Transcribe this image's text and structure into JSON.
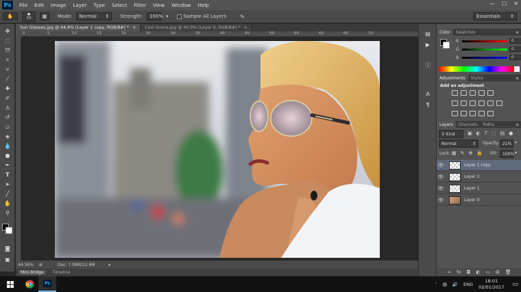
{
  "app": {
    "logo": "Ps"
  },
  "menu": [
    "File",
    "Edit",
    "Image",
    "Layer",
    "Type",
    "Select",
    "Filter",
    "View",
    "Window",
    "Help"
  ],
  "window_controls": [
    "—",
    "☐",
    "✕"
  ],
  "options_bar": {
    "brush_size": "70",
    "mode_label": "Mode:",
    "mode_value": "Normal",
    "strength_label": "Strength:",
    "strength_value": "100%",
    "sample_all_layers": "Sample All Layers",
    "workspace": "Essentials"
  },
  "tabs": [
    {
      "title": "Sun Glasses.jpg @ 44.4% (Layer 1 copy, RGB/8#) *",
      "close": "×"
    },
    {
      "title": "Cool Scene.jpg @ 40.9% (Layer 0, RGB/8#) *",
      "close": "×"
    }
  ],
  "ruler_ticks": [
    "0",
    "5",
    "10",
    "15",
    "20",
    "25",
    "30",
    "35",
    "40",
    "45",
    "50",
    "55",
    "60",
    "65",
    "70"
  ],
  "status_bar": {
    "zoom": "44.36%",
    "doc": "Doc: 7.06M/12.6M"
  },
  "bottom_tabs": [
    "Mini Bridge",
    "Timeline"
  ],
  "color_panel": {
    "tabs": [
      "Color",
      "Swatches"
    ],
    "channels": [
      {
        "label": "R",
        "value": "0"
      },
      {
        "label": "G",
        "value": "0"
      },
      {
        "label": "B",
        "value": "0"
      }
    ]
  },
  "adjustments_panel": {
    "tabs": [
      "Adjustments",
      "Styles"
    ],
    "heading": "Add an adjustment"
  },
  "layers_panel": {
    "tabs": [
      "Layers",
      "Channels",
      "Paths"
    ],
    "filter_kind": "Kind",
    "blend_mode": "Normal",
    "opacity_label": "Opacity:",
    "opacity_value": "21%",
    "lock_label": "Lock:",
    "fill_label": "Fill:",
    "fill_value": "100%",
    "layers": [
      {
        "name": "Layer 1 copy",
        "selected": true
      },
      {
        "name": "Layer 2",
        "selected": false
      },
      {
        "name": "Layer 1",
        "selected": false
      },
      {
        "name": "Layer 0",
        "selected": false
      }
    ]
  },
  "taskbar": {
    "language": "ENG",
    "time": "18:01",
    "date": "02/01/2017"
  },
  "colors": {
    "accent": "#31a8ff",
    "selection": "#5f6b7c",
    "panel": "#535353"
  }
}
